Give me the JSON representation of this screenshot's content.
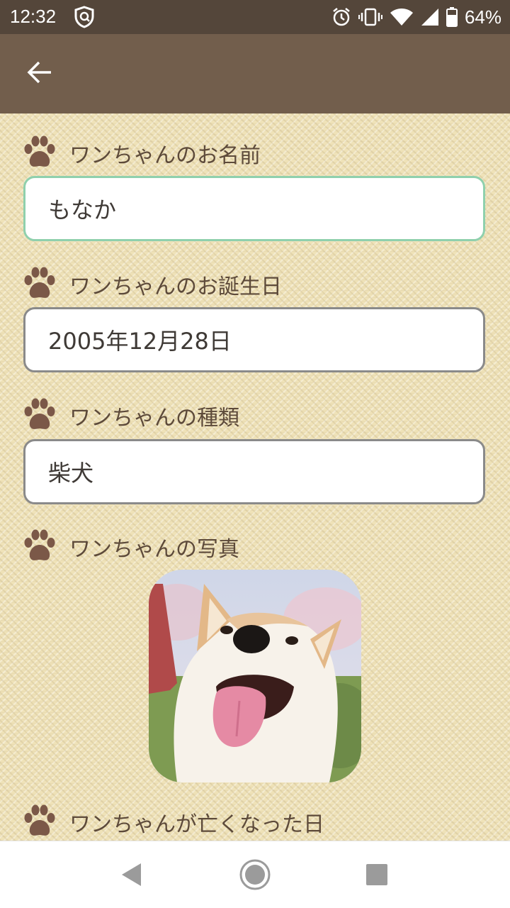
{
  "status_bar": {
    "time": "12:32",
    "battery": "64%",
    "icons": [
      "vpn-shield-icon",
      "alarm-icon",
      "vibrate-icon",
      "wifi-icon",
      "signal-icon",
      "battery-icon"
    ]
  },
  "toolbar": {
    "back_icon": "arrow-left-icon"
  },
  "form": {
    "name_label": "ワンちゃんのお名前",
    "name_value": "もなか",
    "birthday_label": "ワンちゃんのお誕生日",
    "birthday_value": "2005年12月28日",
    "breed_label": "ワンちゃんの種類",
    "breed_value": "柴犬",
    "photo_label": "ワンちゃんの写真",
    "death_date_label": "ワンちゃんが亡くなった日"
  },
  "nav": {
    "icons": [
      "back-triangle-icon",
      "home-circle-icon",
      "recents-square-icon"
    ]
  },
  "colors": {
    "status_bar": "#54463a",
    "toolbar": "#725e4c",
    "label_text": "#5d4a3a",
    "paw": "#7b5848",
    "focused_border": "#8fd0ad",
    "input_border": "#8a8a8a"
  }
}
